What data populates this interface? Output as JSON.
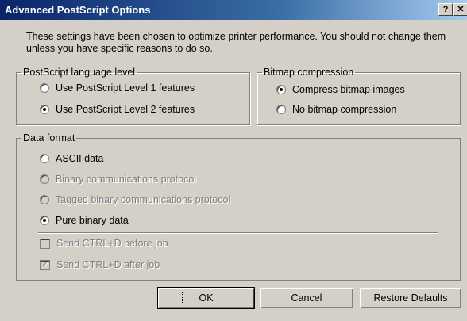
{
  "window": {
    "title": "Advanced PostScript Options",
    "help_label": "?",
    "close_label": "✕"
  },
  "intro_text": "These settings have been chosen to optimize printer performance. You should not change them unless you have specific reasons to do so.",
  "language_level": {
    "legend": "PostScript language level",
    "options": [
      {
        "label": "Use PostScript Level 1 features",
        "checked": false
      },
      {
        "label": "Use PostScript Level 2 features",
        "checked": true
      }
    ]
  },
  "bitmap_compression": {
    "legend": "Bitmap compression",
    "options": [
      {
        "label": "Compress bitmap images",
        "checked": true
      },
      {
        "label": "No bitmap compression",
        "checked": false
      }
    ]
  },
  "data_format": {
    "legend": "Data format",
    "options": [
      {
        "label": "ASCII data",
        "checked": false,
        "enabled": true
      },
      {
        "label": "Binary communications protocol",
        "checked": false,
        "enabled": false
      },
      {
        "label": "Tagged binary communications protocol",
        "checked": false,
        "enabled": false
      },
      {
        "label": "Pure binary data",
        "checked": true,
        "enabled": true
      }
    ],
    "checkboxes": [
      {
        "label": "Send CTRL+D before job",
        "checked": false,
        "enabled": false
      },
      {
        "label": "Send CTRL+D after job",
        "checked": true,
        "enabled": false
      }
    ]
  },
  "buttons": {
    "ok": "OK",
    "cancel": "Cancel",
    "restore": "Restore Defaults"
  }
}
